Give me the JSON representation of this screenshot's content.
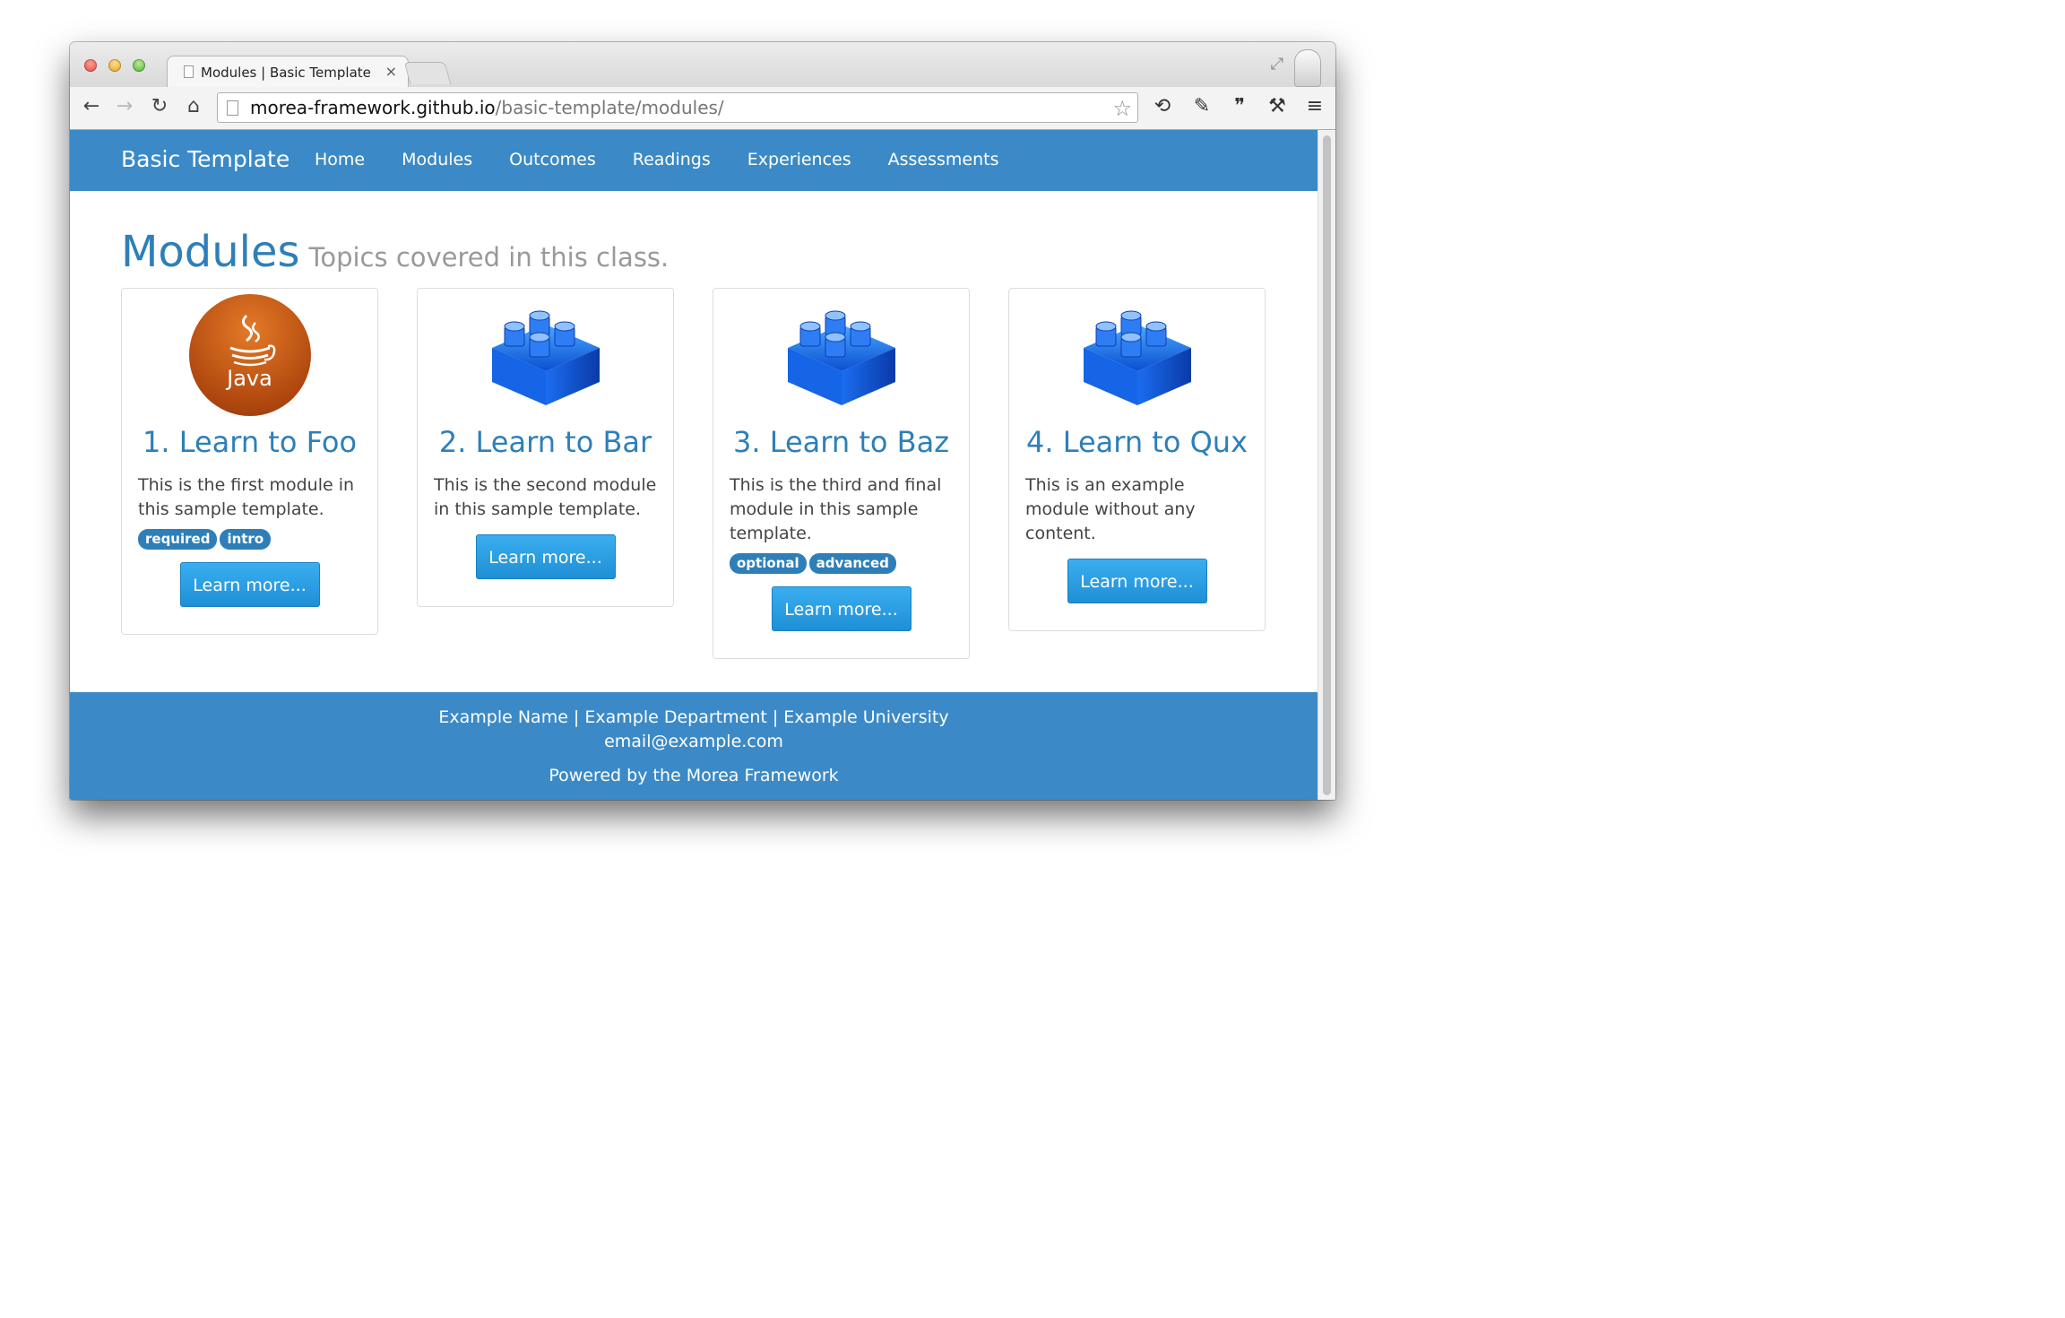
{
  "browser": {
    "tab_title": "Modules | Basic Template",
    "tab_close": "×",
    "url_host": "morea-framework.github.io",
    "url_path": "/basic-template/modules/"
  },
  "site": {
    "brand": "Basic Template",
    "nav": [
      "Home",
      "Modules",
      "Outcomes",
      "Readings",
      "Experiences",
      "Assessments"
    ]
  },
  "page": {
    "title": "Modules",
    "subtitle": "Topics covered in this class."
  },
  "modules": [
    {
      "title": "1. Learn to Foo",
      "desc": "This is the first module in this sample template.",
      "labels": [
        "required",
        "intro"
      ],
      "button": "Learn more...",
      "icon": "java-icon",
      "icon_text": "Java"
    },
    {
      "title": "2. Learn to Bar",
      "desc": "This is the second module in this sample template.",
      "labels": [],
      "button": "Learn more...",
      "icon": "lego-block-icon"
    },
    {
      "title": "3. Learn to Baz",
      "desc": "This is the third and final module in this sample template.",
      "labels": [
        "optional",
        "advanced"
      ],
      "button": "Learn more...",
      "icon": "lego-block-icon"
    },
    {
      "title": "4. Learn to Qux",
      "desc": "This is an example module without any content.",
      "labels": [],
      "button": "Learn more...",
      "icon": "lego-block-icon"
    }
  ],
  "footer": {
    "line1": "Example Name | Example Department | Example University",
    "line2": "email@example.com",
    "line3": "Powered by the Morea Framework"
  },
  "colors": {
    "primary": "#3b8ac7",
    "heading": "#2e7fb8",
    "button": "#2a9fe6"
  }
}
